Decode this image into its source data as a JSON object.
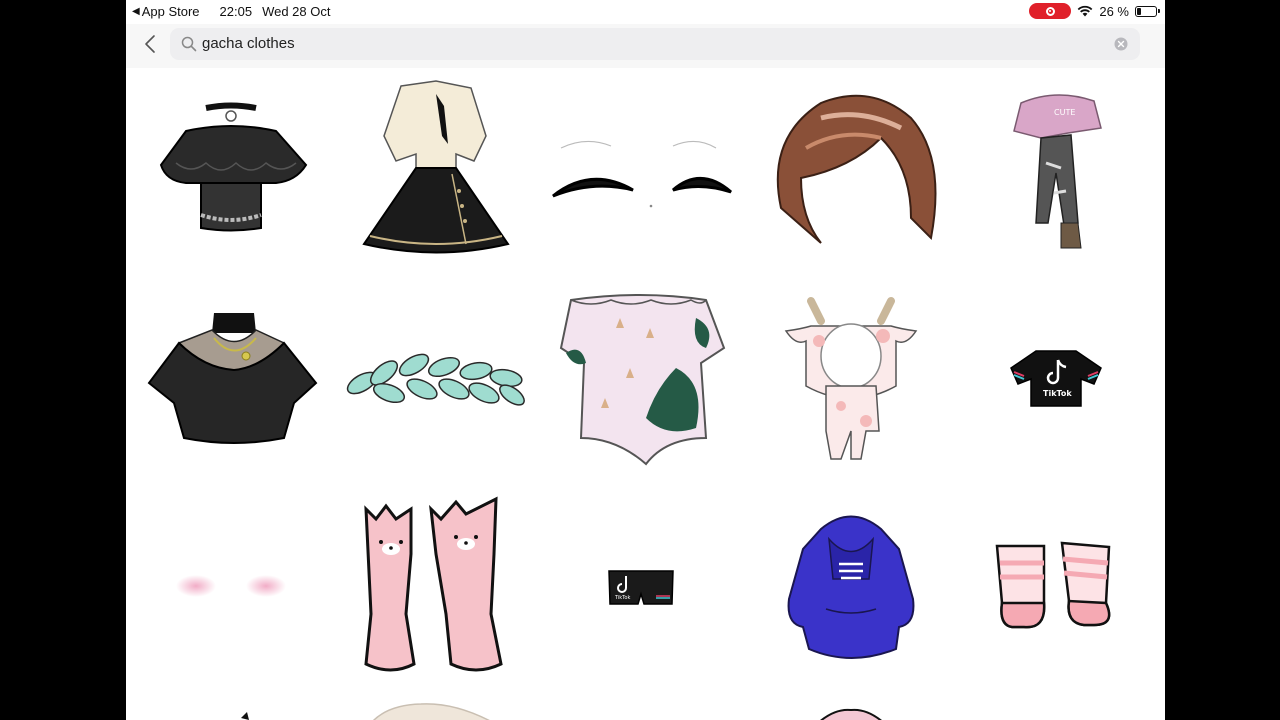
{
  "status_bar": {
    "back_app": "App Store",
    "time": "22:05",
    "date": "Wed 28 Oct",
    "battery": "26 %",
    "battery_level": 0.26
  },
  "search": {
    "query": "gacha clothes"
  },
  "results": [
    {
      "icon": "black-ruffle-top-icon"
    },
    {
      "icon": "school-uniform-skirt-icon"
    },
    {
      "icon": "closed-eyes-icon"
    },
    {
      "icon": "brown-hair-icon"
    },
    {
      "icon": "pink-sweater-jeans-icon"
    },
    {
      "icon": "black-top-necklace-icon"
    },
    {
      "icon": "leaf-crown-icon"
    },
    {
      "icon": "floral-romper-icon"
    },
    {
      "icon": "cow-onesie-icon"
    },
    {
      "icon": "tiktok-shirt-icon"
    },
    {
      "icon": "blush-icon"
    },
    {
      "icon": "bear-stockings-icon"
    },
    {
      "icon": "tiktok-shorts-icon"
    },
    {
      "icon": "blue-hoodie-icon"
    },
    {
      "icon": "striped-socks-icon"
    }
  ],
  "colors": {
    "record_pill": "#e0202a"
  }
}
